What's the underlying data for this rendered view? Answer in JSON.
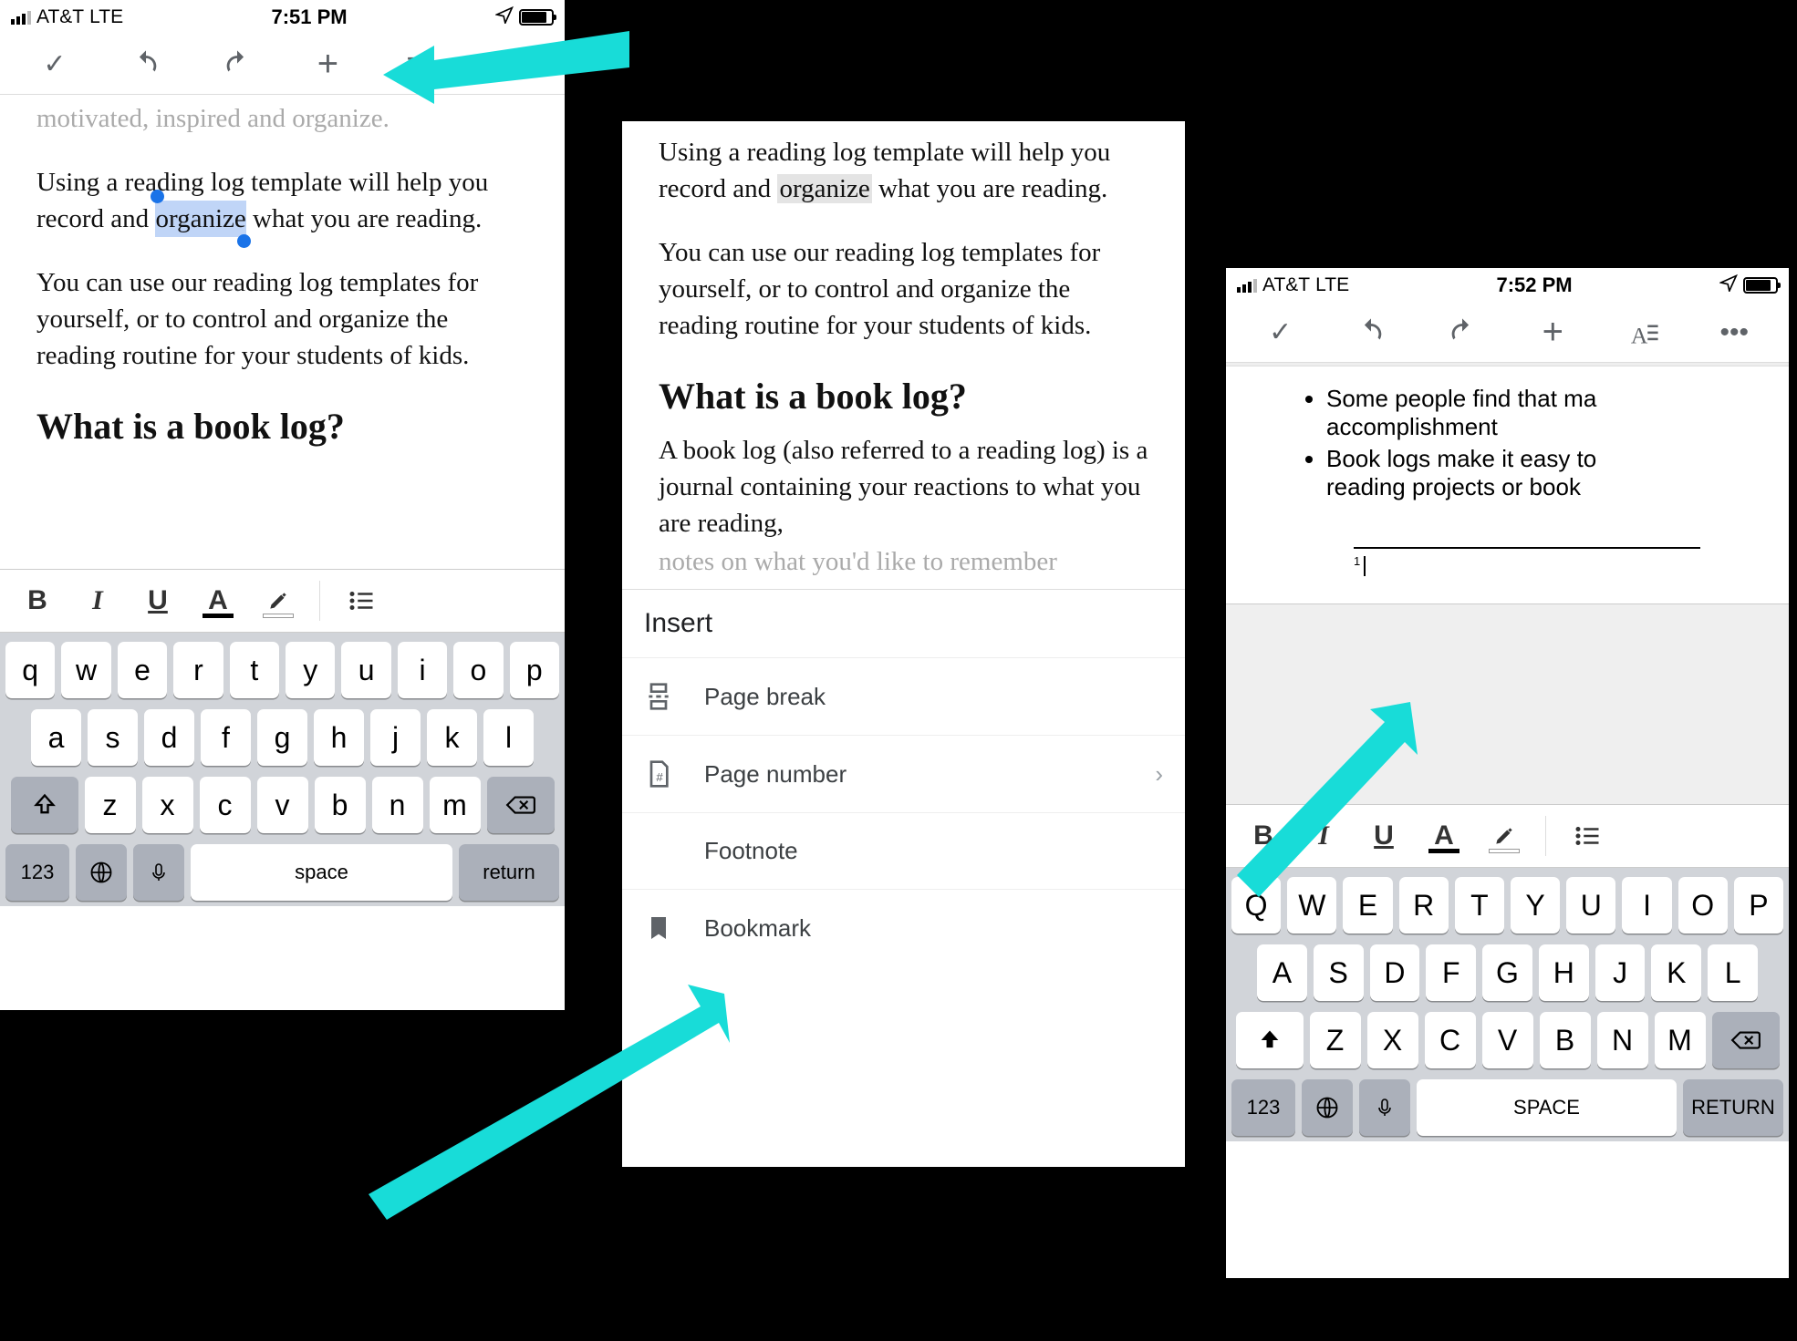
{
  "phones": {
    "p1": {
      "status": {
        "carrier": "AT&T",
        "network": "LTE",
        "time": "7:51 PM"
      },
      "doc": {
        "cutoff": "motivated, inspired and organize.",
        "para1a": "Using a reading log template will help you record and ",
        "selected_word": "organize",
        "para1b": " what you are reading.",
        "para2": "You can use our reading log templates for yourself, or to control and organize the reading routine for your students of kids.",
        "heading": "What is a book log?"
      }
    },
    "p2": {
      "doc": {
        "para1a": "Using a reading log template will help you record and ",
        "highlighted_word": "organize",
        "para1b": " what you are reading.",
        "para2": "You can use our reading log templates for yourself, or to control and organize the reading routine for your students of kids.",
        "heading": "What is a book log?",
        "para3": "A book log (also referred to a reading log) is a journal containing your reactions to what you are reading,",
        "para3_cut": "notes on what you'd like to remember"
      },
      "sheet": {
        "title": "Insert",
        "items": [
          {
            "label": "Page break",
            "icon": "page-break",
            "has_more": false
          },
          {
            "label": "Page number",
            "icon": "page-number",
            "has_more": true
          },
          {
            "label": "Footnote",
            "icon": "footnote",
            "has_more": false
          },
          {
            "label": "Bookmark",
            "icon": "bookmark",
            "has_more": false
          }
        ]
      }
    },
    "p3": {
      "status": {
        "carrier": "AT&T",
        "network": "LTE",
        "time": "7:52 PM"
      },
      "doc": {
        "bullet1a": "Some people find that ma",
        "bullet1b": "accomplishment",
        "bullet2a": "Book logs make it easy to",
        "bullet2b": "reading projects or book",
        "footnote_num": "1"
      }
    }
  },
  "format_bar": {
    "b": "B",
    "i": "I",
    "u": "U",
    "a": "A"
  },
  "keyboard": {
    "row1": [
      "q",
      "w",
      "e",
      "r",
      "t",
      "y",
      "u",
      "i",
      "o",
      "p"
    ],
    "row2": [
      "a",
      "s",
      "d",
      "f",
      "g",
      "h",
      "j",
      "k",
      "l"
    ],
    "row3": [
      "z",
      "x",
      "c",
      "v",
      "b",
      "n",
      "m"
    ],
    "num_key": "123",
    "space": "space",
    "ret": "return"
  }
}
